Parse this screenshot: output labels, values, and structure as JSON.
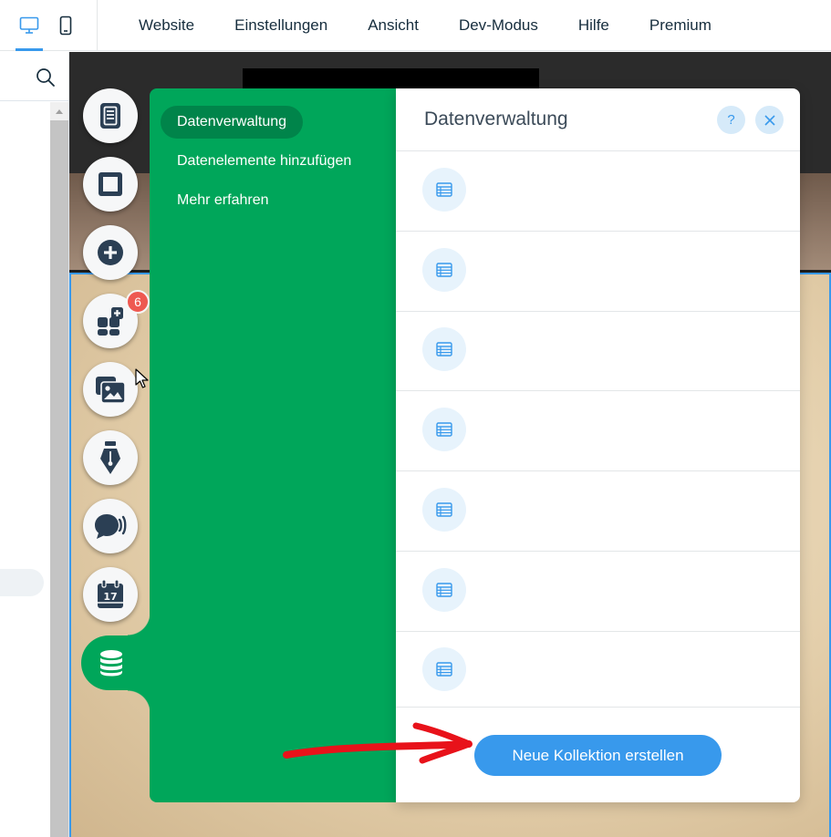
{
  "topbar": {
    "devices": [
      {
        "label": "Desktop",
        "icon": "desktop-icon",
        "active": true
      },
      {
        "label": "Mobil",
        "icon": "mobile-icon",
        "active": false
      }
    ],
    "menu": [
      "Website",
      "Einstellungen",
      "Ansicht",
      "Dev-Modus",
      "Hilfe",
      "Premium"
    ]
  },
  "sidebar_tools": [
    {
      "name": "pages",
      "icon": "pages-icon"
    },
    {
      "name": "background",
      "icon": "square-icon"
    },
    {
      "name": "add",
      "icon": "plus-circle-icon"
    },
    {
      "name": "apps",
      "icon": "apps-icon",
      "badge": "6"
    },
    {
      "name": "media",
      "icon": "media-icon"
    },
    {
      "name": "blog",
      "icon": "pen-nib-icon"
    },
    {
      "name": "chat",
      "icon": "chat-icon"
    },
    {
      "name": "bookings",
      "icon": "calendar-icon",
      "calendar_day": "17"
    },
    {
      "name": "database",
      "icon": "database-icon",
      "active": true
    }
  ],
  "panel": {
    "nav": [
      {
        "label": "Datenverwaltung",
        "active": true
      },
      {
        "label": "Datenelemente hinzufügen",
        "active": false
      },
      {
        "label": "Mehr erfahren",
        "active": false
      }
    ],
    "title": "Datenverwaltung",
    "help_label": "?",
    "collections_count": 7,
    "create_button": "Neue Kollektion erstellen"
  },
  "colors": {
    "accent": "#3899ec",
    "green": "#00a65a",
    "green_active": "#00844a",
    "badge": "#ee5951",
    "annotation_arrow": "#e8121a"
  }
}
